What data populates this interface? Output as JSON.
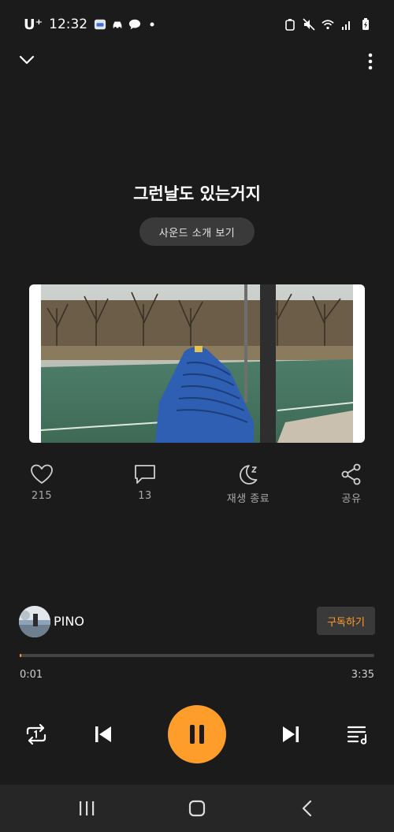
{
  "status_bar": {
    "carrier": "U⁺",
    "time": "12:32"
  },
  "track": {
    "title": "그런날도 있는거지",
    "intro_label": "사운드 소개 보기"
  },
  "actions": {
    "like_count": "215",
    "comment_count": "13",
    "sleep_label": "재생 종료",
    "share_label": "공유"
  },
  "artist": {
    "name": "PINO",
    "subscribe_label": "구독하기"
  },
  "playback": {
    "current_time": "0:01",
    "total_time": "3:35",
    "progress": 0.005
  },
  "colors": {
    "accent": "#ff9d2b",
    "background": "#1b1b1b"
  }
}
